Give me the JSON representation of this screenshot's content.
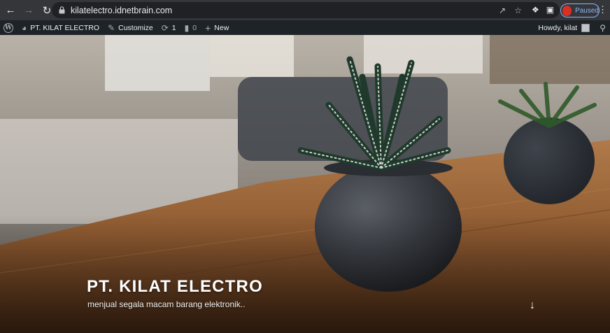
{
  "browser": {
    "back_icon": "back-arrow-icon",
    "forward_icon": "forward-arrow-icon",
    "reload_icon": "reload-icon",
    "url": "kilatelectro.idnetbrain.com",
    "profile_status": "Paused"
  },
  "admin_bar": {
    "customize_label": "Customize",
    "updates_count": "1",
    "comments_count": "0",
    "new_label": "New",
    "site_name": "PT. KILAT ELECTRO",
    "greeting": "Howdy, kilat"
  },
  "hero": {
    "title": "PT. KILAT ELECTRO",
    "tagline": "menjual segala macam barang elektronik.."
  },
  "colors": {
    "admin_bar": "#1d2327",
    "browser_chrome": "#35363a",
    "paused_accent": "#8ab4f8"
  }
}
